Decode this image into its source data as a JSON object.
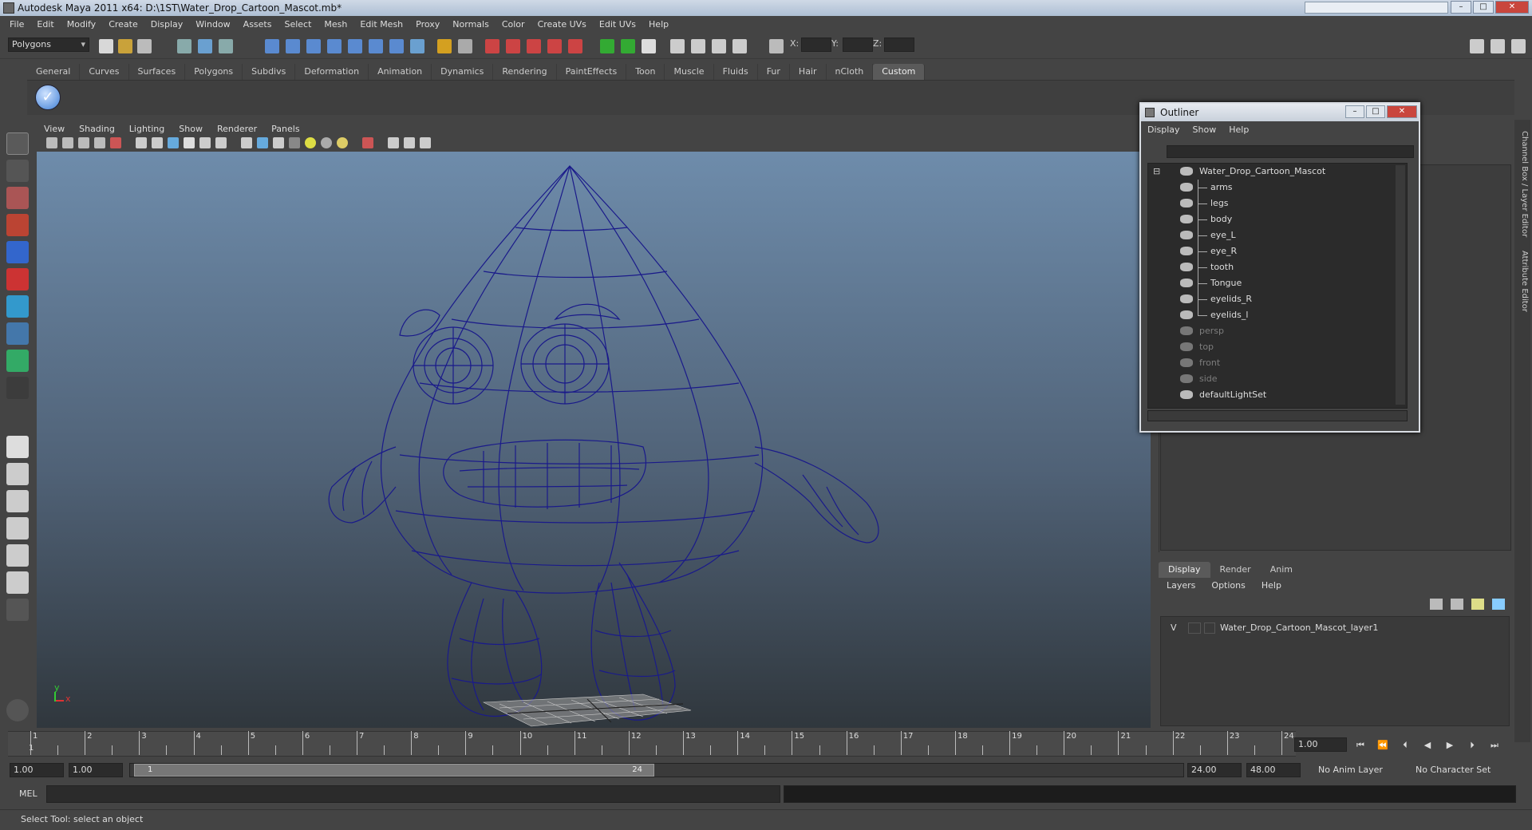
{
  "window": {
    "title": "Autodesk Maya 2011 x64: D:\\1ST\\Water_Drop_Cartoon_Mascot.mb*",
    "controls": [
      "–",
      "□",
      "✕"
    ]
  },
  "menubar": [
    "File",
    "Edit",
    "Modify",
    "Create",
    "Display",
    "Window",
    "Assets",
    "Select",
    "Mesh",
    "Edit Mesh",
    "Proxy",
    "Normals",
    "Color",
    "Create UVs",
    "Edit UVs",
    "Help"
  ],
  "statusline": {
    "mode": "Polygons",
    "x_label": "X:",
    "y_label": "Y:",
    "z_label": "Z:"
  },
  "shelf": {
    "tabs": [
      "General",
      "Curves",
      "Surfaces",
      "Polygons",
      "Subdivs",
      "Deformation",
      "Animation",
      "Dynamics",
      "Rendering",
      "PaintEffects",
      "Toon",
      "Muscle",
      "Fluids",
      "Fur",
      "Hair",
      "nCloth",
      "Custom"
    ],
    "active_tab": "Custom",
    "icon": "checkmark-icon"
  },
  "viewport": {
    "menu": [
      "View",
      "Shading",
      "Lighting",
      "Show",
      "Renderer",
      "Panels"
    ],
    "axis_y": "y",
    "axis_x": "x",
    "wire_color": "#1a1a8a"
  },
  "outliner": {
    "title": "Outliner",
    "menu": [
      "Display",
      "Show",
      "Help"
    ],
    "items": [
      {
        "label": "Water_Drop_Cartoon_Mascot",
        "level": 0,
        "dim": false,
        "expanded": true
      },
      {
        "label": "arms",
        "level": 1,
        "dim": false
      },
      {
        "label": "legs",
        "level": 1,
        "dim": false
      },
      {
        "label": "body",
        "level": 1,
        "dim": false
      },
      {
        "label": "eye_L",
        "level": 1,
        "dim": false
      },
      {
        "label": "eye_R",
        "level": 1,
        "dim": false
      },
      {
        "label": "tooth",
        "level": 1,
        "dim": false
      },
      {
        "label": "Tongue",
        "level": 1,
        "dim": false
      },
      {
        "label": "eyelids_R",
        "level": 1,
        "dim": false
      },
      {
        "label": "eyelids_l",
        "level": 1,
        "dim": false
      },
      {
        "label": "persp",
        "level": 0,
        "dim": true
      },
      {
        "label": "top",
        "level": 0,
        "dim": true
      },
      {
        "label": "front",
        "level": 0,
        "dim": true
      },
      {
        "label": "side",
        "level": 0,
        "dim": true
      },
      {
        "label": "defaultLightSet",
        "level": 0,
        "dim": false
      }
    ]
  },
  "side_tabs": [
    "Channel Box / Layer Editor",
    "Attribute Editor"
  ],
  "layer_editor": {
    "tabs": [
      "Display",
      "Render",
      "Anim"
    ],
    "active_tab": "Display",
    "menu": [
      "Layers",
      "Options",
      "Help"
    ],
    "layer": {
      "visible": "V",
      "name": "Water_Drop_Cartoon_Mascot_layer1"
    }
  },
  "timeline": {
    "frames": [
      1,
      2,
      3,
      4,
      5,
      6,
      7,
      8,
      9,
      10,
      11,
      12,
      13,
      14,
      15,
      16,
      17,
      18,
      19,
      20,
      21,
      22,
      23,
      24
    ],
    "current_frame_label": "1",
    "current_frame": "1.00"
  },
  "range": {
    "start": "1.00",
    "playback_start": "1.00",
    "handle_start": "1",
    "handle_end": "24",
    "playback_end": "24.00",
    "end": "48.00",
    "anim_layer": "No Anim Layer",
    "character_set": "No Character Set"
  },
  "command": {
    "label": "MEL"
  },
  "help_line": "Select Tool: select an object"
}
